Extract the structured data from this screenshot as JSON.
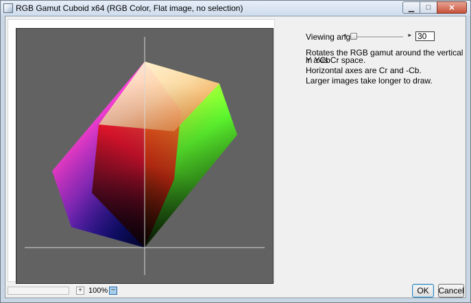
{
  "window": {
    "title": "RGB Gamut Cuboid x64 (RGB Color, Flat image, no selection)",
    "icons": {
      "app": "app-icon",
      "minimize": "minimize-icon",
      "maximize": "maximize-icon",
      "close": "close-icon"
    }
  },
  "controls": {
    "viewing_angle_label": "Viewing angle",
    "viewing_angle_value": "30",
    "slider_left_arrow": "◂",
    "slider_right_arrow": "▸"
  },
  "info": {
    "line1": "Rotates the RGB gamut around the vertical Y axis",
    "line2": "in YCbCr space.",
    "line3": "Horizontal axes are Cr and -Cb.",
    "line4": "Larger images take longer to draw."
  },
  "statusbar": {
    "zoom_in_label": "+",
    "zoom_value": "100%",
    "zoom_out_label": "−"
  },
  "buttons": {
    "ok": "OK",
    "cancel": "Cancel"
  },
  "colors": {
    "canvas_bg": "#626262",
    "axis": "#d8d8d8",
    "white": "#ffffff",
    "yellow": "#ffff00",
    "green": "#00ff00",
    "red": "#ff0000",
    "magenta": "#ff00ff",
    "blue": "#0000ff",
    "black": "#000000"
  }
}
